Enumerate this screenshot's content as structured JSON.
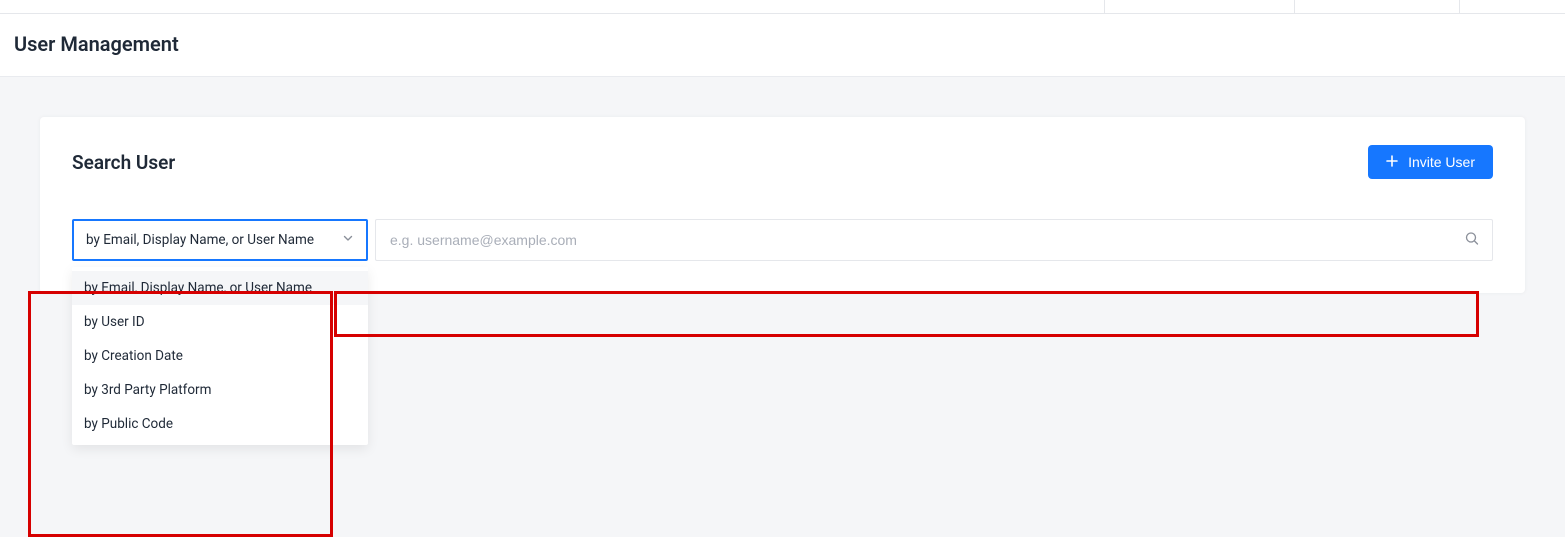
{
  "header": {
    "page_title": "User Management"
  },
  "card": {
    "title": "Search User",
    "invite_button_label": "Invite User"
  },
  "search": {
    "selected": "by Email, Display Name, or User Name",
    "placeholder": "e.g. username@example.com",
    "options": [
      "by Email, Display Name, or User Name",
      "by User ID",
      "by Creation Date",
      "by 3rd Party Platform",
      "by Public Code"
    ]
  }
}
